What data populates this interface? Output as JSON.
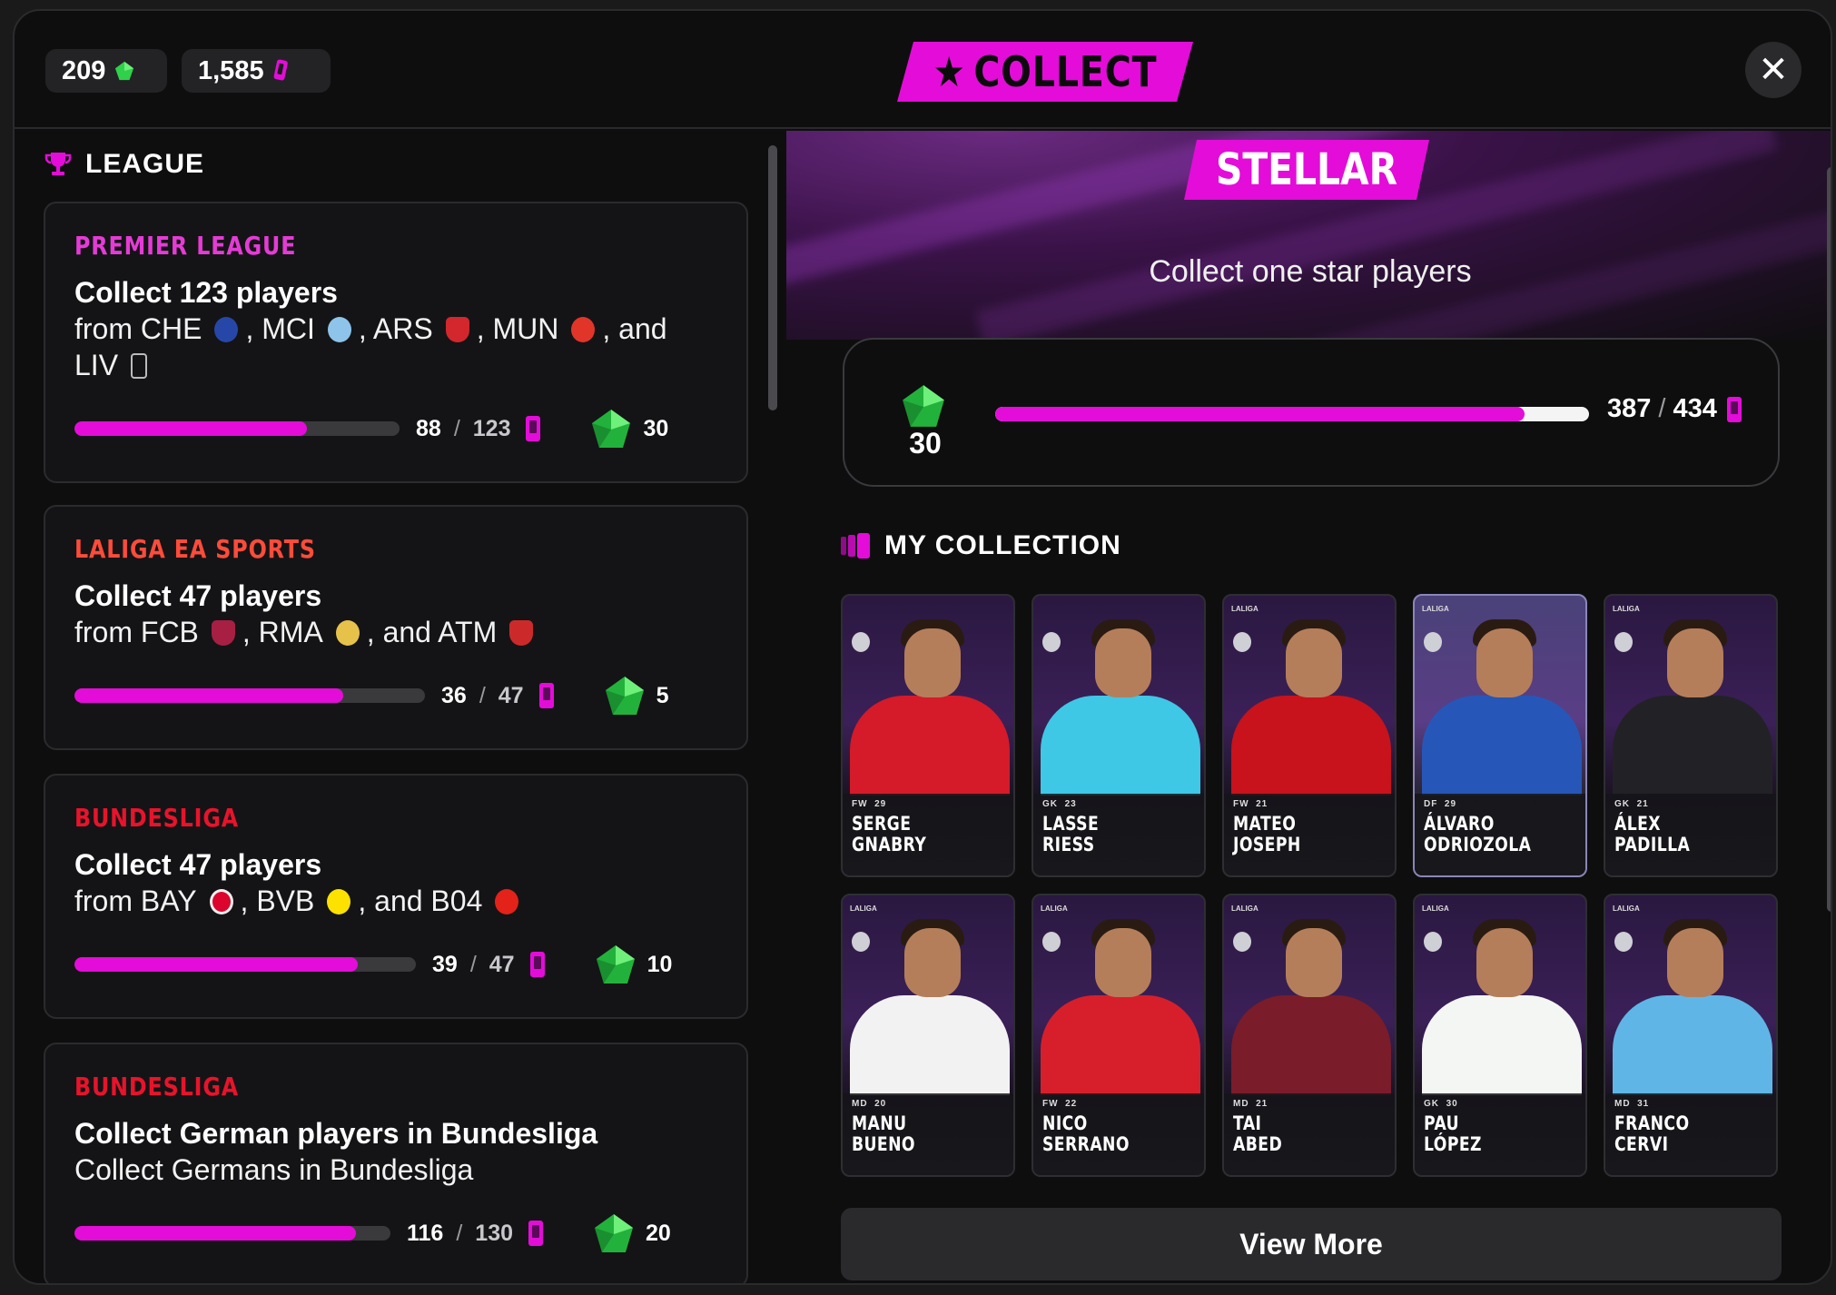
{
  "header": {
    "gems": "209",
    "cards": "1,585",
    "title": "COLLECT",
    "title_icon": "star-icon",
    "close_icon": "close-icon"
  },
  "left": {
    "section_title": "LEAGUE",
    "section_icon": "trophy-icon",
    "leagues": [
      {
        "name": "PREMIER LEAGUE",
        "name_color": "#e53bd6",
        "goal": "Collect 123 players",
        "from_prefix": "from",
        "clubs": [
          "CHE",
          "MCI",
          "ARS",
          "MUN"
        ],
        "clubs_last_joiner": ", and",
        "last_club": "LIV",
        "count": "88",
        "total": "123",
        "progress": 0.715,
        "reward": "30"
      },
      {
        "name": "LALIGA EA SPORTS",
        "name_color": "#ff4b3a",
        "goal": "Collect 47 players",
        "from_prefix": "from",
        "clubs": [
          "FCB",
          "RMA"
        ],
        "clubs_last_joiner": ", and",
        "last_club": "ATM",
        "count": "36",
        "total": "47",
        "progress": 0.766,
        "reward": "5"
      },
      {
        "name": "BUNDESLIGA",
        "name_color": "#e8132b",
        "goal": "Collect 47 players",
        "from_prefix": "from",
        "clubs": [
          "BAY",
          "BVB"
        ],
        "clubs_last_joiner": ", and",
        "last_club": "B04",
        "count": "39",
        "total": "47",
        "progress": 0.83,
        "reward": "10"
      },
      {
        "name": "BUNDESLIGA",
        "name_color": "#e8132b",
        "goal": "Collect German players in Bundesliga",
        "subtitle": "Collect Germans in Bundesliga",
        "count": "116",
        "total": "130",
        "progress": 0.892,
        "reward": "20"
      }
    ]
  },
  "right": {
    "tier_label": "STELLAR",
    "tier_subtitle": "Collect one star players",
    "reward": "30",
    "count": "387",
    "total": "434",
    "progress": 0.892,
    "collection_title": "MY COLLECTION",
    "collection_icon": "cards-icon",
    "view_more": "View More",
    "players": [
      {
        "first": "SERGE",
        "last": "GNABRY",
        "pos": "FW",
        "age": "29",
        "league": "",
        "shirt": "#d51a2a",
        "shiny": false
      },
      {
        "first": "LASSE",
        "last": "RIESS",
        "pos": "GK",
        "age": "23",
        "league": "",
        "shirt": "#3fc7e6",
        "shiny": false
      },
      {
        "first": "MATEO",
        "last": "JOSEPH",
        "pos": "FW",
        "age": "21",
        "league": "LALIGA",
        "shirt": "#c8121c",
        "shiny": false
      },
      {
        "first": "ÁLVARO",
        "last": "ODRIOZOLA",
        "pos": "DF",
        "age": "29",
        "league": "LALIGA",
        "shirt": "#2657b8",
        "shiny": true
      },
      {
        "first": "ÁLEX",
        "last": "PADILLA",
        "pos": "GK",
        "age": "21",
        "league": "LALIGA",
        "shirt": "#222226",
        "shiny": false
      },
      {
        "first": "MANU",
        "last": "BUENO",
        "pos": "MD",
        "age": "20",
        "league": "LALIGA",
        "shirt": "#f2f2f2",
        "shiny": false
      },
      {
        "first": "NICO",
        "last": "SERRANO",
        "pos": "FW",
        "age": "22",
        "league": "LALIGA",
        "shirt": "#d71f2b",
        "shiny": false
      },
      {
        "first": "TAI",
        "last": "ABED",
        "pos": "MD",
        "age": "21",
        "league": "LALIGA",
        "shirt": "#7a1c2a",
        "shiny": false
      },
      {
        "first": "PAU",
        "last": "LÓPEZ",
        "pos": "GK",
        "age": "30",
        "league": "LALIGA",
        "shirt": "#f4f6f4",
        "shiny": false
      },
      {
        "first": "FRANCO",
        "last": "CERVI",
        "pos": "MD",
        "age": "31",
        "league": "LALIGA",
        "shirt": "#5fb6e6",
        "shiny": false
      }
    ]
  },
  "colors": {
    "accent": "#e40cd9",
    "gem": "#2fd14a",
    "background": "#0e0e0f"
  }
}
